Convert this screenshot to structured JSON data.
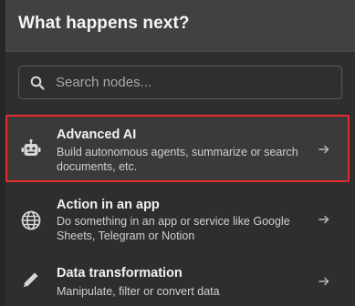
{
  "header": {
    "title": "What happens next?"
  },
  "search": {
    "placeholder": "Search nodes...",
    "value": "",
    "icon": "search-icon"
  },
  "items": [
    {
      "icon": "robot-icon",
      "title": "Advanced AI",
      "description": "Build autonomous agents, summarize or search documents, etc.",
      "highlighted": true
    },
    {
      "icon": "globe-icon",
      "title": "Action in an app",
      "description": "Do something in an app or service like Google Sheets, Telegram or Notion",
      "highlighted": false
    },
    {
      "icon": "pen-icon",
      "title": "Data transformation",
      "description": "Manipulate, filter or convert data",
      "highlighted": false
    }
  ],
  "colors": {
    "background": "#2e2e2e",
    "header_background": "#414141",
    "highlight_border": "#e52b2b",
    "text_primary": "#f2f2f2",
    "text_secondary": "#d0d0d0"
  }
}
